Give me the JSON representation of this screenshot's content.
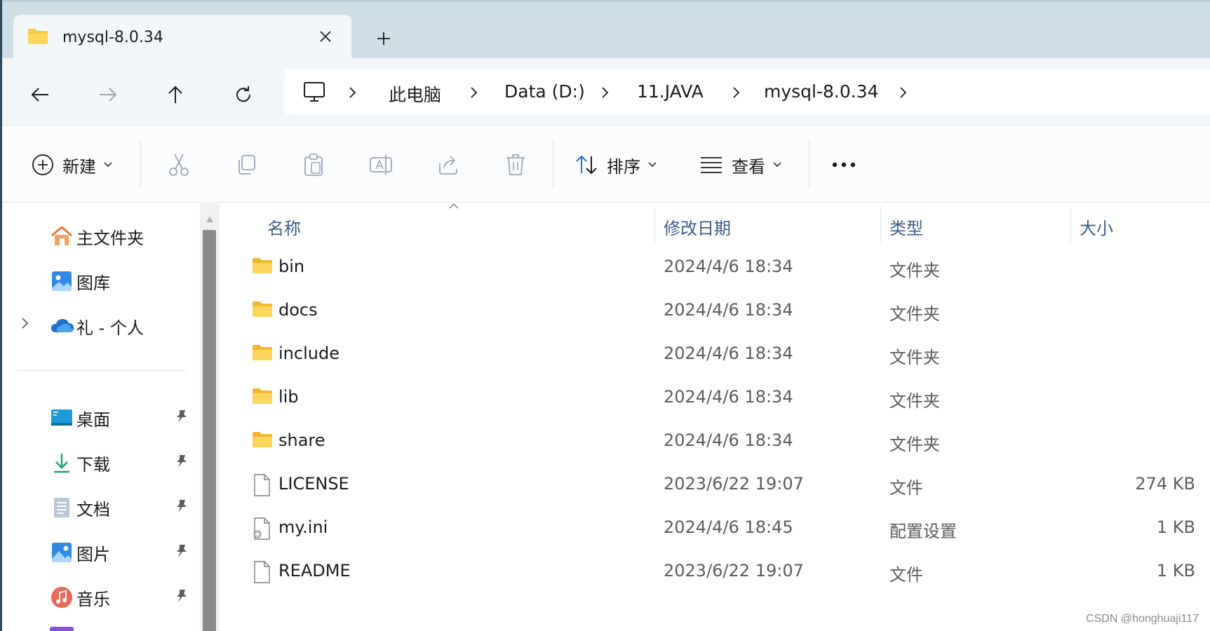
{
  "tab": {
    "title": "mysql-8.0.34"
  },
  "breadcrumb": [
    "此电脑",
    "Data (D:)",
    "11.JAVA",
    "mysql-8.0.34"
  ],
  "commands": {
    "new_label": "新建",
    "sort_label": "排序",
    "view_label": "查看"
  },
  "sidebar": {
    "top_items": [
      {
        "label": "主文件夹",
        "icon": "home-icon"
      },
      {
        "label": "图库",
        "icon": "gallery-icon"
      },
      {
        "label": "礼 - 个人",
        "icon": "onedrive-icon"
      }
    ],
    "pinned_items": [
      {
        "label": "桌面",
        "icon": "desktop-icon"
      },
      {
        "label": "下载",
        "icon": "download-icon"
      },
      {
        "label": "文档",
        "icon": "documents-icon"
      },
      {
        "label": "图片",
        "icon": "pictures-icon"
      },
      {
        "label": "音乐",
        "icon": "music-icon"
      }
    ]
  },
  "columns": {
    "name": "名称",
    "modified": "修改日期",
    "type": "类型",
    "size": "大小"
  },
  "files": [
    {
      "name": "bin",
      "modified": "2024/4/6 18:34",
      "type": "文件夹",
      "size": "",
      "kind": "folder"
    },
    {
      "name": "docs",
      "modified": "2024/4/6 18:34",
      "type": "文件夹",
      "size": "",
      "kind": "folder"
    },
    {
      "name": "include",
      "modified": "2024/4/6 18:34",
      "type": "文件夹",
      "size": "",
      "kind": "folder"
    },
    {
      "name": "lib",
      "modified": "2024/4/6 18:34",
      "type": "文件夹",
      "size": "",
      "kind": "folder"
    },
    {
      "name": "share",
      "modified": "2024/4/6 18:34",
      "type": "文件夹",
      "size": "",
      "kind": "folder"
    },
    {
      "name": "LICENSE",
      "modified": "2023/6/22 19:07",
      "type": "文件",
      "size": "274 KB",
      "kind": "file"
    },
    {
      "name": "my.ini",
      "modified": "2024/4/6 18:45",
      "type": "配置设置",
      "size": "1 KB",
      "kind": "ini"
    },
    {
      "name": "README",
      "modified": "2023/6/22 19:07",
      "type": "文件",
      "size": "1 KB",
      "kind": "file"
    }
  ],
  "watermark": "CSDN @honghuaji117",
  "colors": {
    "folder_yellow": "#f7c948",
    "accent_blue": "#1a73c9",
    "header_text": "#3b5c87"
  }
}
